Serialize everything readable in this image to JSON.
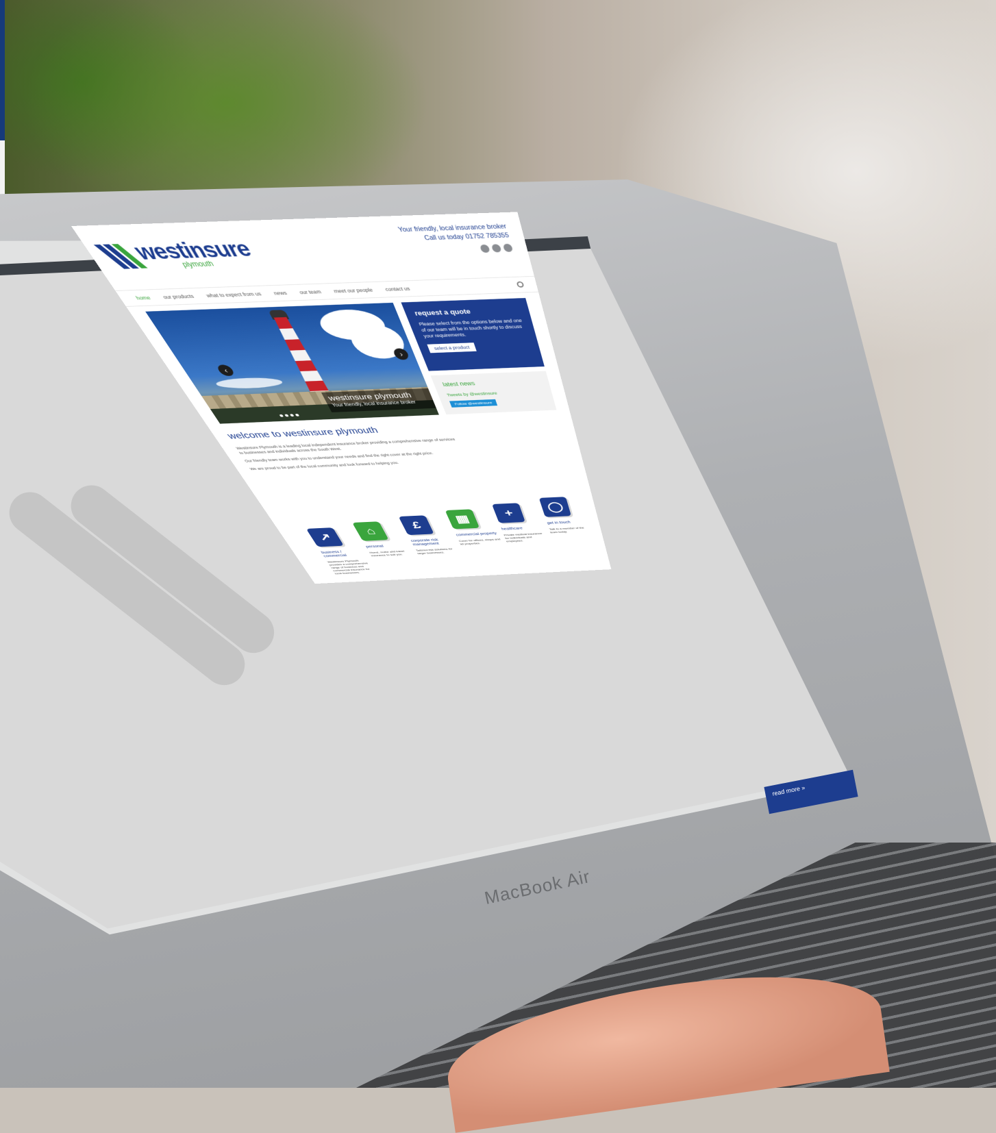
{
  "photo": {
    "device_label": "MacBook Air"
  },
  "site": {
    "logo": {
      "name": "westinsure",
      "sub": "plymouth"
    },
    "tagline_line1": "Your friendly, local insurance broker",
    "tagline_line2": "Call us today 01752 785355",
    "nav": [
      "home",
      "our products",
      "what to expect from us",
      "news",
      "our team",
      "meet our people",
      "contact us"
    ],
    "hero": {
      "title": "westinsure plymouth",
      "subtitle": "Your friendly, local insurance broker",
      "prev_icon": "arrow-left-icon",
      "next_icon": "arrow-right-icon"
    },
    "quote": {
      "title": "request a quote",
      "text": "Please select from the options below and one of our team will be in touch shortly to discuss your requirements.",
      "button": "select a product"
    },
    "tweets": {
      "title": "latest news",
      "line": "Tweets by @westinsure",
      "follow": "Follow @westinsure"
    },
    "welcome": {
      "title": "welcome to westinsure plymouth",
      "p1": "Westinsure Plymouth is a leading local independent insurance broker providing a comprehensive range of services to businesses and individuals across the South West.",
      "p2": "Our friendly team works with you to understand your needs and find the right cover at the right price.",
      "p3": "We are proud to be part of the local community and look forward to helping you."
    },
    "services": [
      {
        "icon": "chart-arrow-icon",
        "glyph": "↗",
        "color": "blue",
        "title": "business / commercial",
        "text": "Westinsure Plymouth provides a comprehensive range of business and commercial insurance for local businesses."
      },
      {
        "icon": "house-icon",
        "glyph": "⌂",
        "color": "green",
        "title": "personal",
        "text": "Home, motor and travel insurance to suit you."
      },
      {
        "icon": "pound-icon",
        "glyph": "£",
        "color": "blue",
        "title": "corporate risk management",
        "text": "Tailored risk solutions for larger businesses."
      },
      {
        "icon": "building-icon",
        "glyph": "▦",
        "color": "green",
        "title": "commercial property",
        "text": "Cover for offices, shops and let properties."
      },
      {
        "icon": "plus-icon",
        "glyph": "+",
        "color": "blue",
        "title": "healthcare",
        "text": "Private medical insurance for individuals and employees."
      },
      {
        "icon": "speech-icon",
        "glyph": "◯",
        "color": "blue",
        "title": "get in touch",
        "text": "Talk to a member of the team today."
      }
    ],
    "read_more": "read more »"
  }
}
